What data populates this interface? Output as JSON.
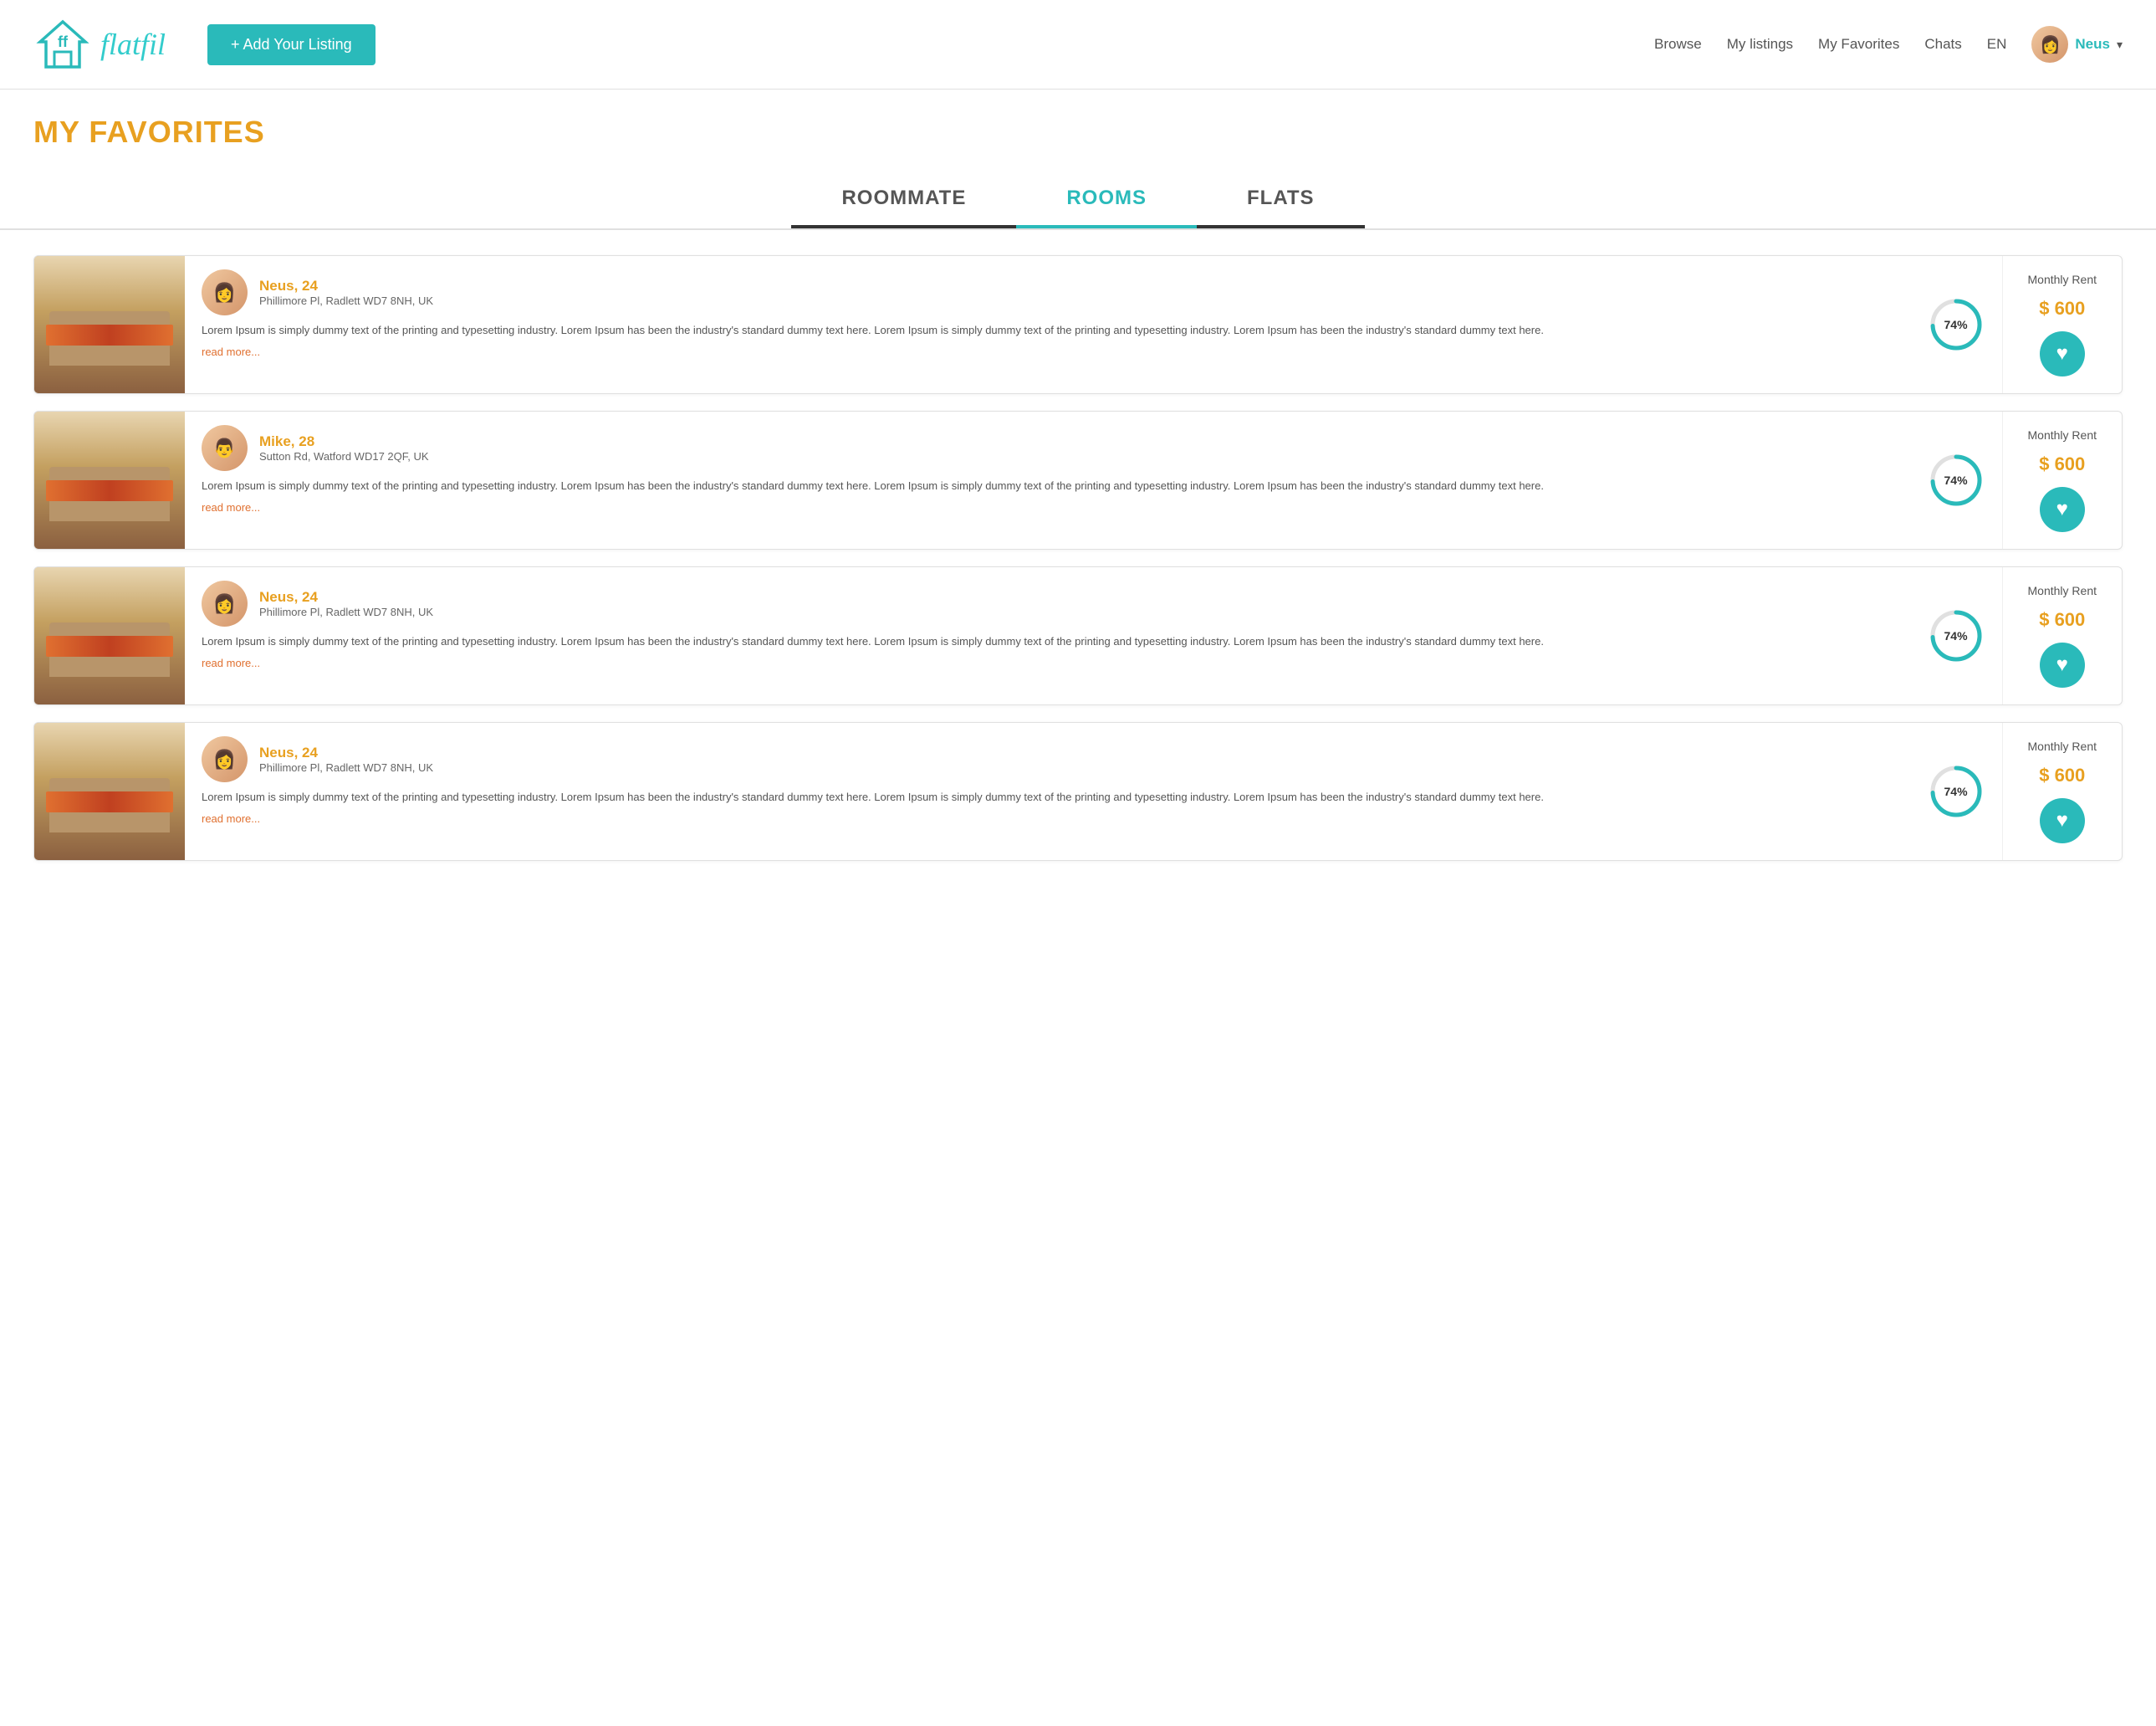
{
  "header": {
    "logo_text": "flatfil",
    "add_listing_label": "+ Add Your Listing",
    "nav": {
      "browse": "Browse",
      "my_listings": "My listings",
      "my_favorites": "My Favorites",
      "chats": "Chats",
      "language": "EN"
    },
    "user": {
      "name": "Neus",
      "avatar_emoji": "👩"
    }
  },
  "page": {
    "title": "MY FAVORITES"
  },
  "tabs": [
    {
      "id": "roommate",
      "label": "ROOMMATE",
      "active": false
    },
    {
      "id": "rooms",
      "label": "ROOMS",
      "active": true
    },
    {
      "id": "flats",
      "label": "FLATS",
      "active": false
    }
  ],
  "listings": [
    {
      "user_name": "Neus, 24",
      "address": "Phillimore Pl, Radlett WD7 8NH, UK",
      "match_percent": "74%",
      "match_value": 74,
      "description": "Lorem Ipsum is simply dummy text of the printing and typesetting industry. Lorem Ipsum has been the industry's standard dummy text here. Lorem Ipsum is simply dummy text of the printing and typesetting industry. Lorem Ipsum has been the industry's standard dummy text here.",
      "read_more": "read more...",
      "monthly_rent_label": "Monthly Rent",
      "price": "$ 600",
      "is_favorited": true,
      "avatar_emoji": "👩"
    },
    {
      "user_name": "Mike, 28",
      "address": "Sutton Rd, Watford WD17 2QF, UK",
      "match_percent": "74%",
      "match_value": 74,
      "description": "Lorem Ipsum is simply dummy text of the printing and typesetting industry. Lorem Ipsum has been the industry's standard dummy text here. Lorem Ipsum is simply dummy text of the printing and typesetting industry. Lorem Ipsum has been the industry's standard dummy text here.",
      "read_more": "read more...",
      "monthly_rent_label": "Monthly Rent",
      "price": "$ 600",
      "is_favorited": true,
      "avatar_emoji": "👨"
    },
    {
      "user_name": "Neus, 24",
      "address": "Phillimore Pl, Radlett WD7 8NH, UK",
      "match_percent": "74%",
      "match_value": 74,
      "description": "Lorem Ipsum is simply dummy text of the printing and typesetting industry. Lorem Ipsum has been the industry's standard dummy text here. Lorem Ipsum is simply dummy text of the printing and typesetting industry. Lorem Ipsum has been the industry's standard dummy text here.",
      "read_more": "read more...",
      "monthly_rent_label": "Monthly Rent",
      "price": "$ 600",
      "is_favorited": true,
      "avatar_emoji": "👩"
    },
    {
      "user_name": "Neus, 24",
      "address": "Phillimore Pl, Radlett WD7 8NH, UK",
      "match_percent": "74%",
      "match_value": 74,
      "description": "Lorem Ipsum is simply dummy text of the printing and typesetting industry. Lorem Ipsum has been the industry's standard dummy text here. Lorem Ipsum is simply dummy text of the printing and typesetting industry. Lorem Ipsum has been the industry's standard dummy text here.",
      "read_more": "read more...",
      "monthly_rent_label": "Monthly Rent",
      "price": "$ 600",
      "is_favorited": true,
      "avatar_emoji": "👩"
    }
  ],
  "colors": {
    "teal": "#2ababa",
    "orange": "#e8a020",
    "dark_orange": "#e07030",
    "text_dark": "#333",
    "text_mid": "#555",
    "border": "#e0e0e0"
  }
}
